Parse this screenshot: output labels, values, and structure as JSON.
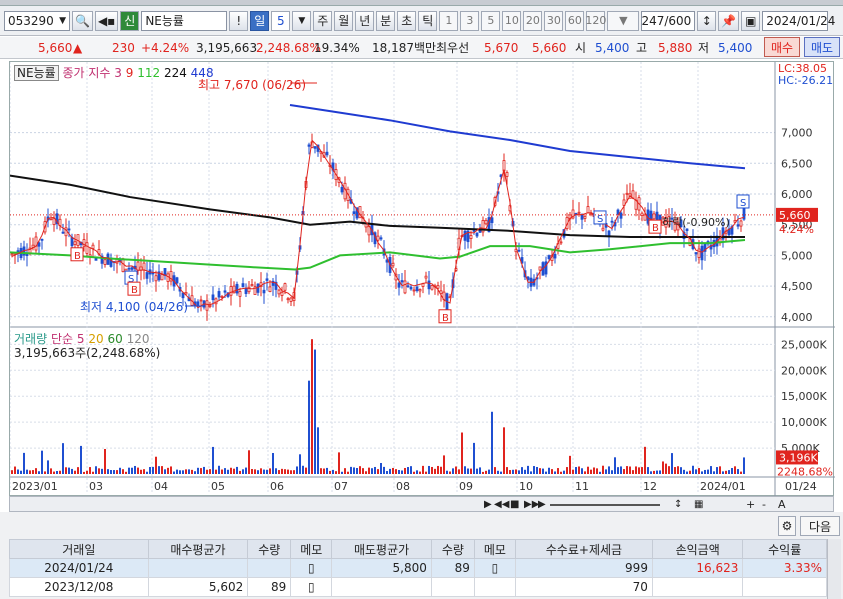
{
  "toolbar": {
    "code": "053290",
    "tag": "신",
    "name": "NE능률",
    "period_sel": "일",
    "period_num": "5",
    "periods": [
      "주",
      "월",
      "년",
      "분",
      "초",
      "틱"
    ],
    "counts": [
      "1",
      "3",
      "5",
      "10",
      "20",
      "30",
      "60",
      "120"
    ],
    "bars": "247/600",
    "date": "2024/01/24"
  },
  "info": {
    "price": "5,660",
    "change": "230",
    "pct": "+4.24%",
    "volume": "3,195,663",
    "vol_pct": "2,248.68%",
    "turnover": "19.34%",
    "amount": "18,187백만",
    "pref_label": "최우선",
    "ask": "5,670",
    "bid": "5,660",
    "open_l": "시",
    "open": "5,400",
    "high_l": "고",
    "high": "5,880",
    "low_l": "저",
    "low": "5,400",
    "buy": "매수",
    "sell": "매도"
  },
  "legend": {
    "name": "NE능률",
    "ma_label": "종가 지수 3",
    "ma": [
      "9",
      "112",
      "224",
      "448"
    ],
    "ma_colors": [
      "#e0241e",
      "#2fbf2f",
      "#111111",
      "#1f3bd1"
    ]
  },
  "annot": {
    "high": "최고 7,670 (06/26)",
    "low": "최저 4,100 (04/26)",
    "drop": "하락(-0.90%)"
  },
  "axis": {
    "lc": "LC:38.05",
    "hc": "HC:-26.21",
    "prices": [
      "7,000",
      "6,500",
      "6,000",
      "5,500",
      "5,000",
      "4,500",
      "4,000"
    ],
    "cur_price": "5,660",
    "cur_pct": "4.24%",
    "vol_ticks": [
      "25,000K",
      "20,000K",
      "15,000K",
      "10,000K",
      "5,000K"
    ],
    "cur_vol": "3,196K",
    "cur_vpct": "2248.68%",
    "months": [
      "2023/01",
      "03",
      "04",
      "05",
      "06",
      "07",
      "08",
      "09",
      "10",
      "11",
      "12",
      "2024/01"
    ],
    "last_month": "01/24"
  },
  "vol_legend": {
    "label": "거래량",
    "ma": "단순",
    "ma_vals": [
      "5",
      "20",
      "60",
      "120"
    ],
    "value": "3,195,663주(2,248.68%)"
  },
  "nav": {
    "plus": "+",
    "minus": "-",
    "auto": "A"
  },
  "lower": {
    "next": "다음"
  },
  "table": {
    "headers": [
      "거래일",
      "매수평균가",
      "수량",
      "메모",
      "매도평균가",
      "수량",
      "메모",
      "수수료+제세금",
      "손익금액",
      "수익률"
    ],
    "rows": [
      [
        "2024/01/24",
        "",
        "",
        "",
        "5,800",
        "89",
        "",
        "999",
        "16,623",
        "3.33%"
      ],
      [
        "2023/12/08",
        "5,602",
        "89",
        "",
        "",
        "",
        "",
        "70",
        "",
        ""
      ]
    ]
  },
  "chart_data": {
    "type": "line",
    "y_range": [
      3850,
      8150
    ],
    "y_label_unit": "KRW",
    "note": "candlestick price with moving averages 3/9/112/224/448 and volume bars"
  }
}
